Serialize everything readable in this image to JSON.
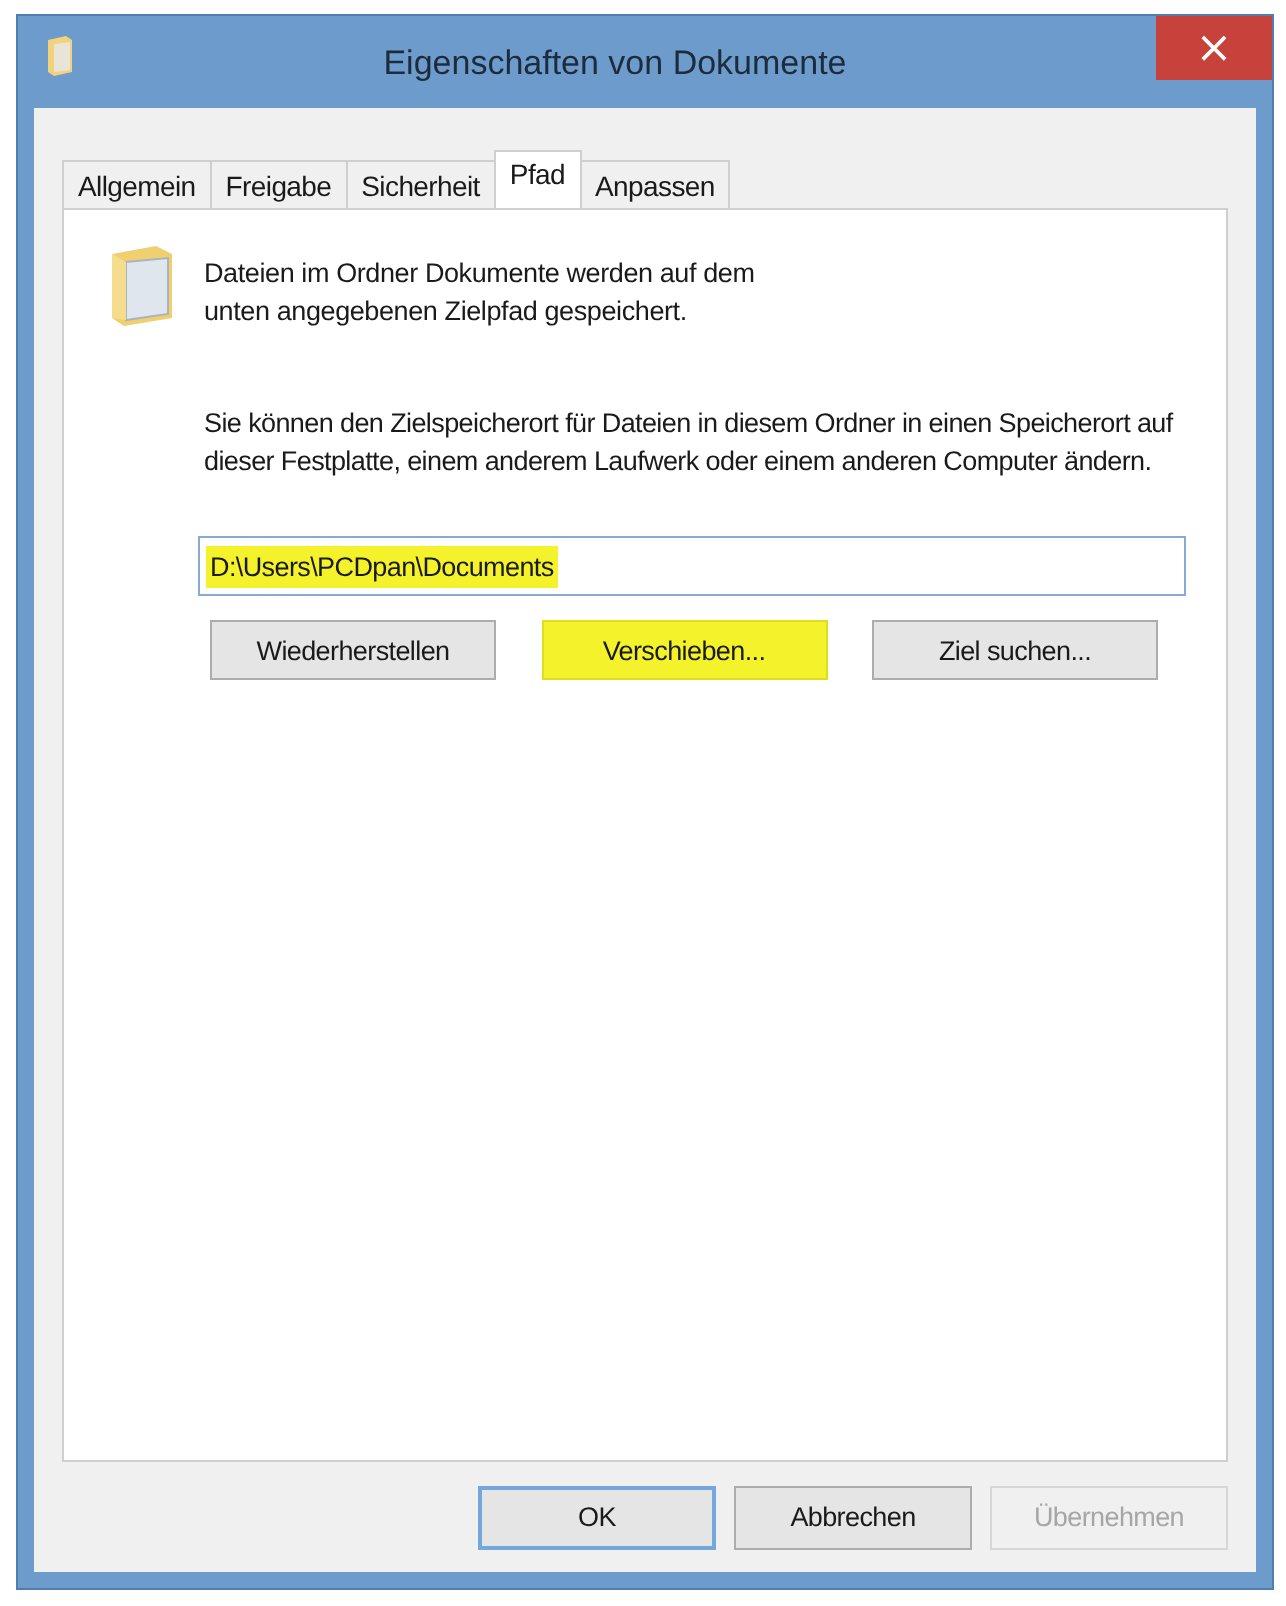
{
  "window": {
    "title": "Eigenschaften von Dokumente",
    "close": "×"
  },
  "tabs": [
    {
      "label": "Allgemein",
      "selected": false
    },
    {
      "label": "Freigabe",
      "selected": false
    },
    {
      "label": "Sicherheit",
      "selected": false
    },
    {
      "label": "Pfad",
      "selected": true
    },
    {
      "label": "Anpassen",
      "selected": false
    }
  ],
  "intro": "Dateien im Ordner Dokumente werden auf dem\nunten angegebenen Zielpfad gespeichert.",
  "description": "Sie können den Zielspeicherort für Dateien in diesem Ordner in einen Speicherort auf dieser Festplatte, einem anderem Laufwerk oder einem anderen Computer ändern.",
  "path_field": {
    "value": "D:\\Users\\PCDpan\\Documents",
    "highlighted": true
  },
  "path_buttons": [
    {
      "label": "Wiederherstellen",
      "highlighted": false
    },
    {
      "label": "Verschieben...",
      "highlighted": true
    },
    {
      "label": "Ziel suchen...",
      "highlighted": false
    }
  ],
  "buttons": [
    {
      "label": "OK",
      "default": true,
      "disabled": false
    },
    {
      "label": "Abbrechen",
      "default": false,
      "disabled": false
    },
    {
      "label": "Übernehmen",
      "default": false,
      "disabled": true
    }
  ]
}
